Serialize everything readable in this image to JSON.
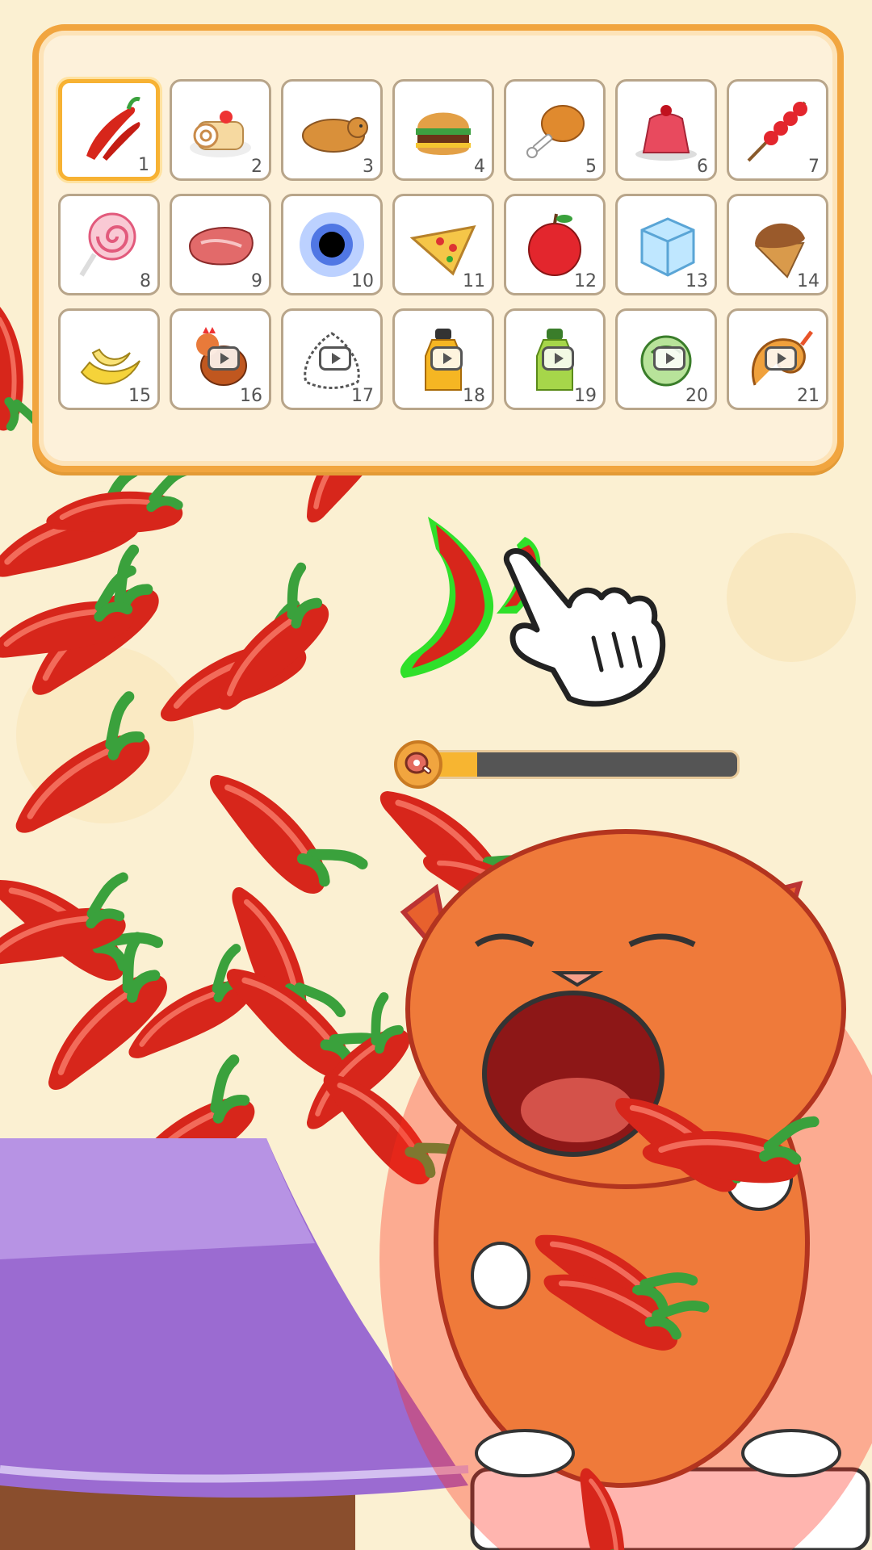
{
  "inventory": {
    "selected": 1,
    "items": [
      {
        "num": "1",
        "icon": "chili-pepper-icon",
        "locked": false
      },
      {
        "num": "2",
        "icon": "swiss-roll-cake-icon",
        "locked": false
      },
      {
        "num": "3",
        "icon": "roast-pig-icon",
        "locked": false
      },
      {
        "num": "4",
        "icon": "burger-icon",
        "locked": false
      },
      {
        "num": "5",
        "icon": "chicken-drumstick-icon",
        "locked": false
      },
      {
        "num": "6",
        "icon": "jelly-pudding-icon",
        "locked": false
      },
      {
        "num": "7",
        "icon": "candied-fruit-skewer-icon",
        "locked": false
      },
      {
        "num": "8",
        "icon": "lollipop-icon",
        "locked": false
      },
      {
        "num": "9",
        "icon": "raw-steak-icon",
        "locked": false
      },
      {
        "num": "10",
        "icon": "black-hole-icon",
        "locked": false
      },
      {
        "num": "11",
        "icon": "pizza-slice-icon",
        "locked": false
      },
      {
        "num": "12",
        "icon": "red-apple-icon",
        "locked": false
      },
      {
        "num": "13",
        "icon": "ice-cube-icon",
        "locked": false
      },
      {
        "num": "14",
        "icon": "ice-cream-cone-icon",
        "locked": false
      },
      {
        "num": "15",
        "icon": "banana-icon",
        "locked": false
      },
      {
        "num": "16",
        "icon": "chicken-icon",
        "locked": true
      },
      {
        "num": "17",
        "icon": "rice-ball-icon",
        "locked": true
      },
      {
        "num": "18",
        "icon": "orange-soda-bottle-icon",
        "locked": true
      },
      {
        "num": "19",
        "icon": "green-soda-bottle-icon",
        "locked": true
      },
      {
        "num": "20",
        "icon": "cabbage-icon",
        "locked": true
      },
      {
        "num": "21",
        "icon": "fried-shrimp-icon",
        "locked": true
      }
    ]
  },
  "fullness": {
    "icon": "meat-icon",
    "value": 0.2
  },
  "colors": {
    "panel_border": "#f1a53f",
    "pepper_red": "#d7261b",
    "pepper_stem": "#3aa13c",
    "cat_orange": "#ef7a3a",
    "tablecloth": "#9b6bd1",
    "highlight_green": "#2fe02a",
    "progress_fill": "#f7b531"
  }
}
